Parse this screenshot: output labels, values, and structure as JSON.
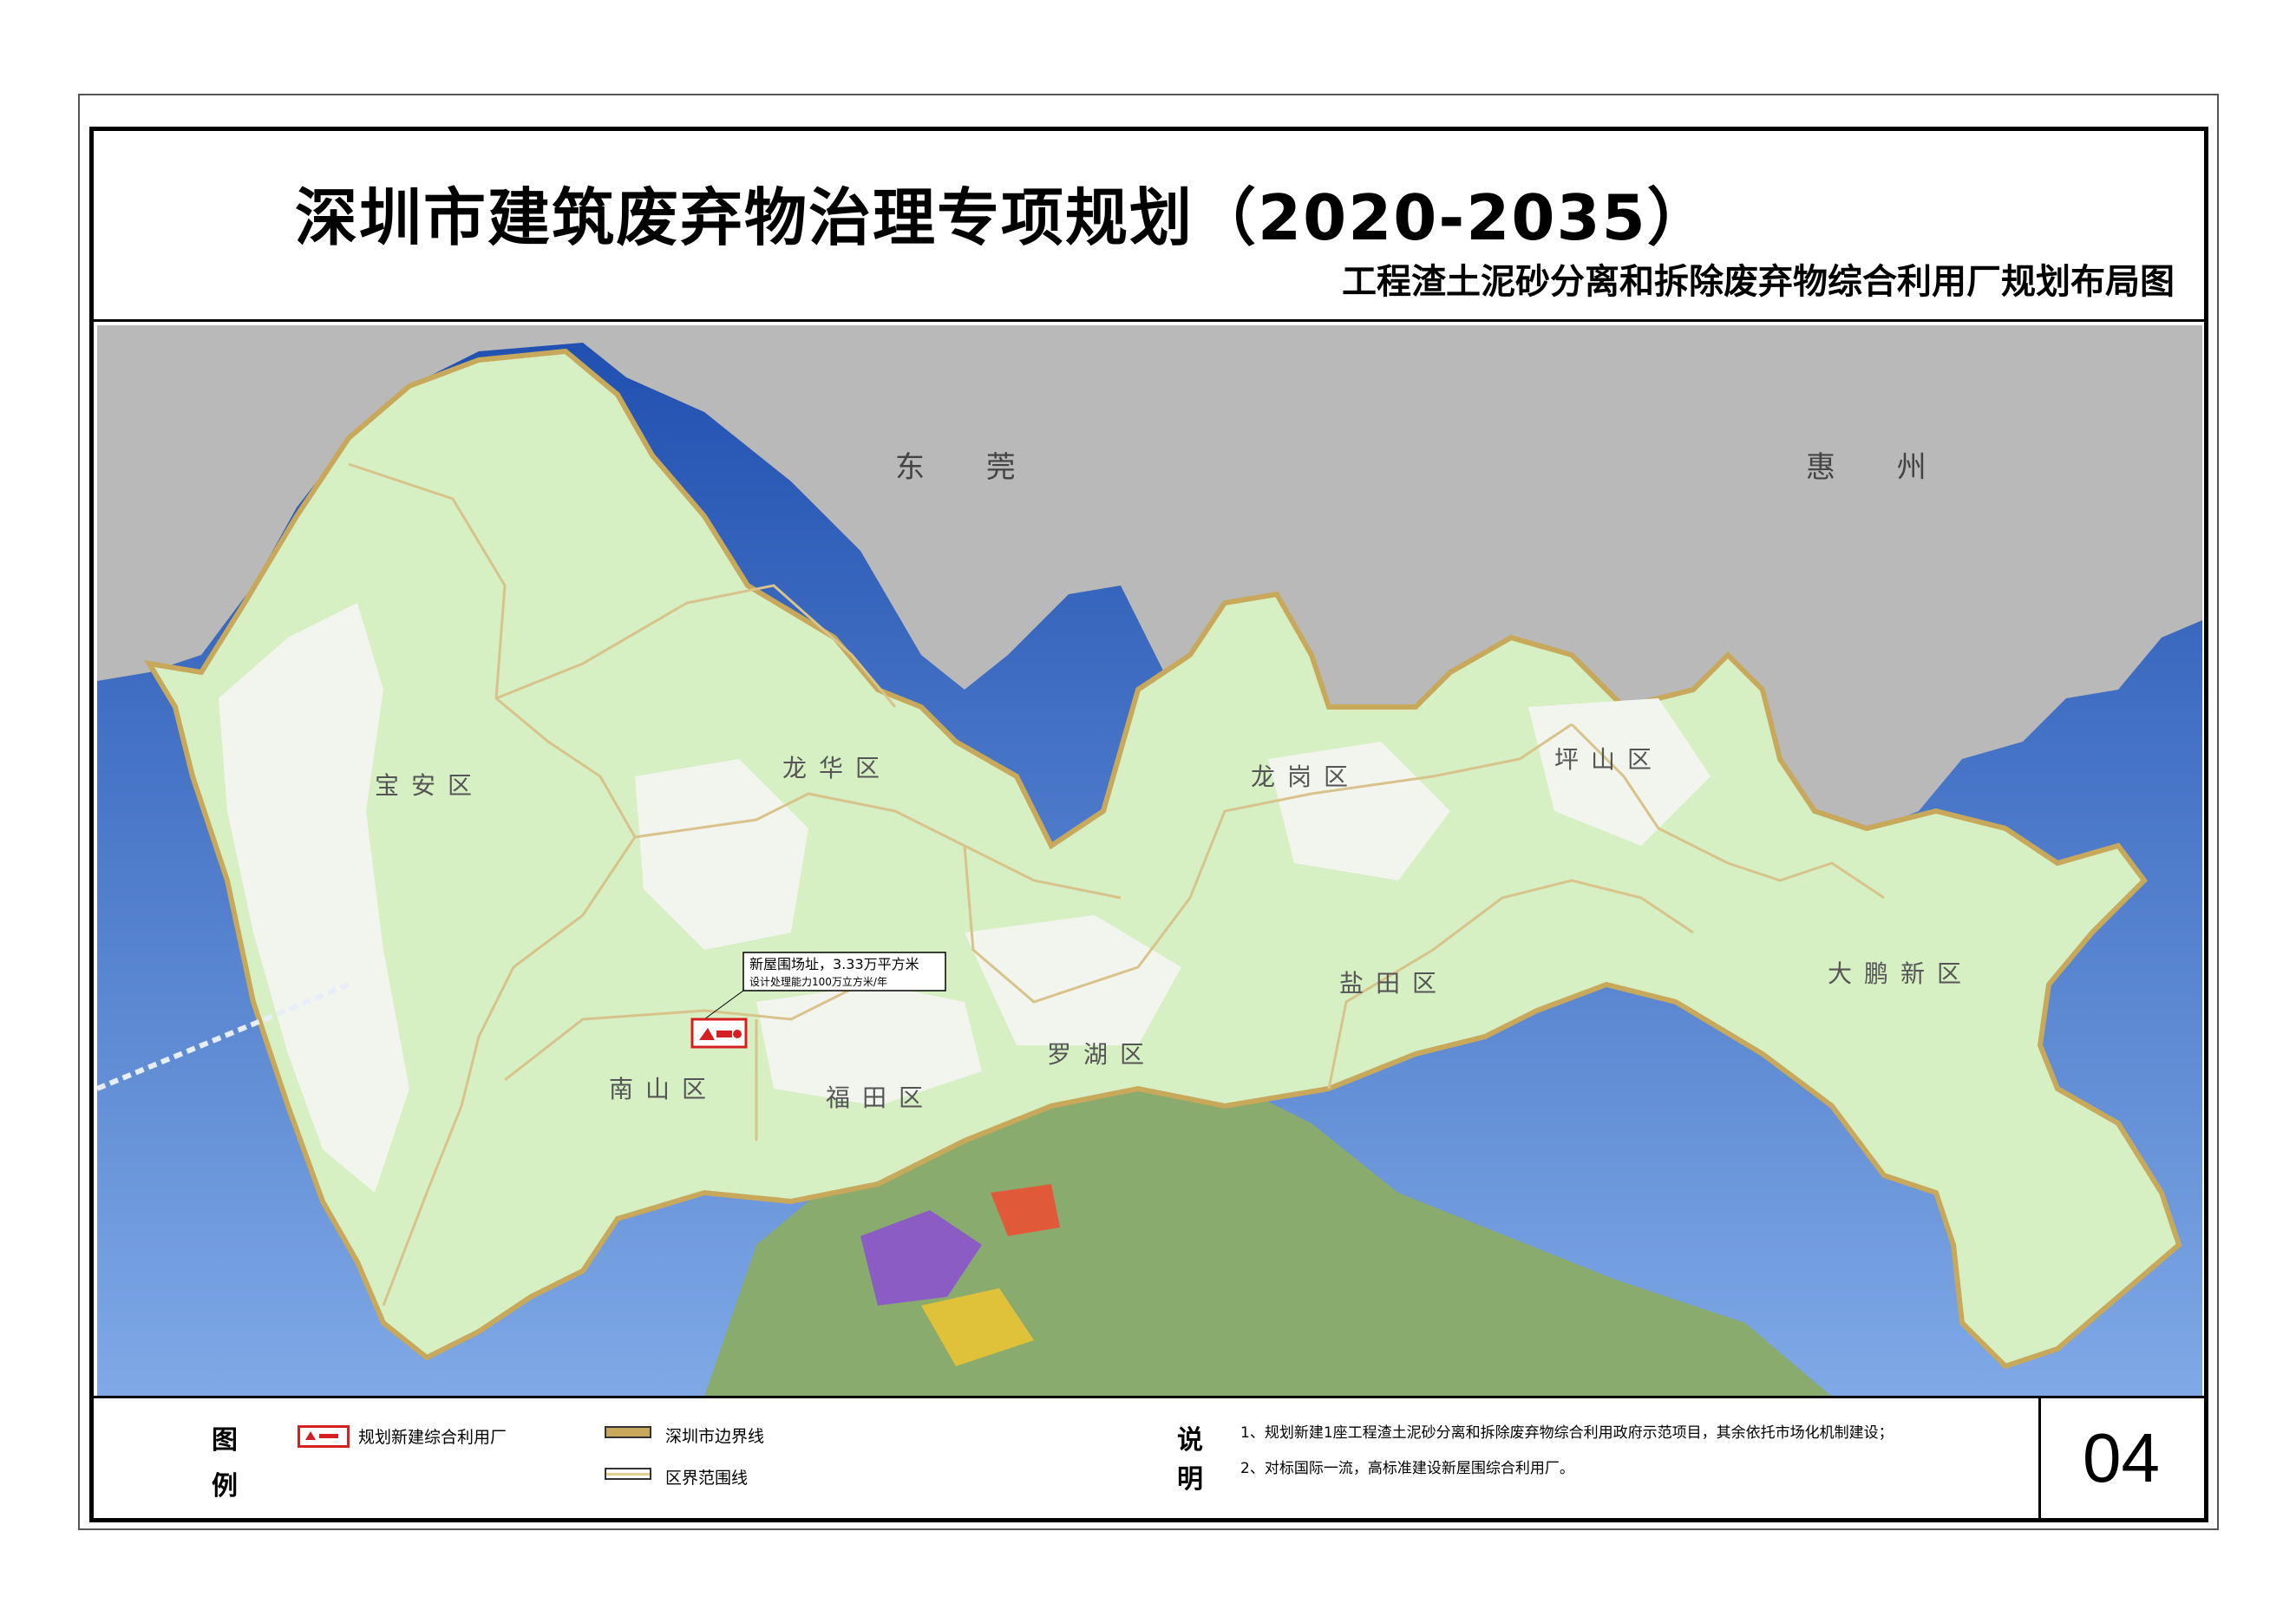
{
  "title": "深圳市建筑废弃物治理专项规划（2020-2035）",
  "subtitle": "工程渣土泥砂分离和拆除废弃物综合利用厂规划布局图",
  "map": {
    "neighbor_cities": [
      "东 莞",
      "惠 州"
    ],
    "districts": [
      "宝安区",
      "龙华区",
      "龙岗区",
      "坪山区",
      "南山区",
      "福田区",
      "罗湖区",
      "盐田区",
      "大鹏新区"
    ],
    "site_callout": {
      "line1": "新屋围场址，3.33万平方米",
      "line2": "设计处理能力100万立方米/年"
    },
    "colors": {
      "sea": "#3566c0",
      "land_green": "#d9f0c7",
      "urban_white": "#f4f7f1",
      "outside_gray": "#b8b8b8",
      "city_boundary": "#c8a85a",
      "site_red": "#d42020"
    }
  },
  "legend": {
    "heading_1": "图",
    "heading_2": "例",
    "items": [
      {
        "label": "规划新建综合利用厂",
        "icon": "planned-plant-icon"
      },
      {
        "label": "深圳市边界线",
        "icon": "city-boundary-line-icon"
      },
      {
        "label": "区界范围线",
        "icon": "district-boundary-line-icon"
      }
    ]
  },
  "notes": {
    "heading_1": "说",
    "heading_2": "明",
    "items": [
      "1、规划新建1座工程渣土泥砂分离和拆除废弃物综合利用政府示范项目，其余依托市场化机制建设；",
      "2、对标国际一流，高标准建设新屋围综合利用厂。"
    ]
  },
  "sheet_number": "04"
}
